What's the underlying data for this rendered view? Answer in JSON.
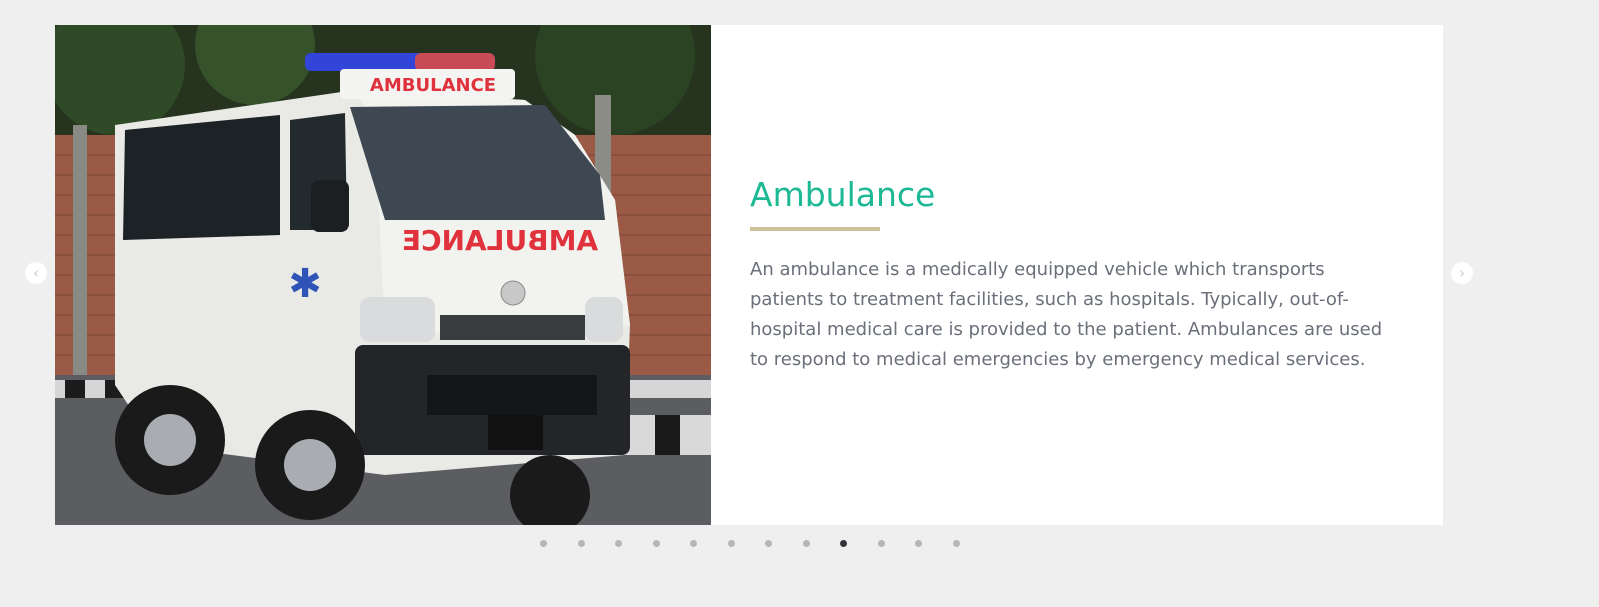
{
  "slide": {
    "title": "Ambulance",
    "description": "An ambulance is a medically equipped vehicle which transports patients to treatment facilities, such as hospitals. Typically, out-of-hospital medical care is provided to the patient. Ambulances are used to respond to medical emergencies by emergency medical services.",
    "image": {
      "subject": "white ambulance van parked in front of a brick wall",
      "roof_text": "AMBULANCE",
      "hood_text": "AMBULANCE"
    }
  },
  "navigation": {
    "prev_icon": "chevron-left-icon",
    "next_icon": "chevron-right-icon",
    "prev_glyph": "‹",
    "next_glyph": "›"
  },
  "pagination": {
    "total": 12,
    "active_index": 8
  },
  "colors": {
    "title": "#1db894",
    "underline": "#cfc09a",
    "text": "#6a6f79",
    "background": "#efefef",
    "dot": "#b6b6b6",
    "dot_active": "#2f3338"
  }
}
